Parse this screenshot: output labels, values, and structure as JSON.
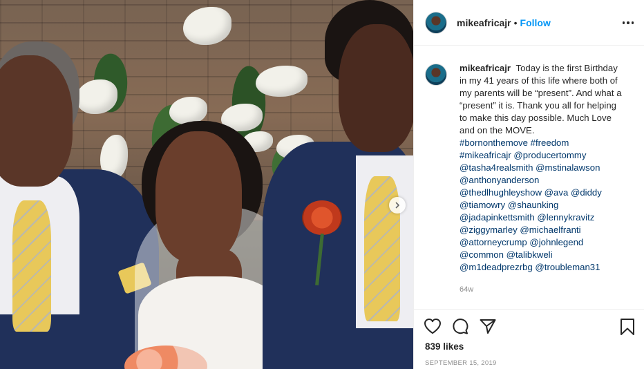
{
  "post": {
    "photo_alt": "",
    "author": "mikeafricajr",
    "separator": "•",
    "follow_label": "Follow",
    "caption_username": "mikeafricajr",
    "caption_text": "Today is the first Birthday in my 41 years of this life where both of my parents will be “present”. And what a “present” it is. Thank you all for helping to make this day possible. Much Love and on the MOVE.",
    "tags": [
      "#bornonthemove #freedom",
      "#mikeafricajr @producertommy",
      "@tasha4realsmith @mstinalawson",
      "@anthonyanderson",
      "@thedlhughleyshow @ava @diddy",
      "@tiamowry @shaunking",
      "@jadapinkettsmith @lennykravitz",
      "@ziggymarley @michaelfranti",
      "@attorneycrump @johnlegend",
      "@common @talibkweli",
      "@m1deadprezrbg @troubleman31"
    ],
    "age": "64w",
    "likes": "839 likes",
    "date": "SEPTEMBER 15, 2019"
  },
  "icons": {
    "like": "heart-icon",
    "comment": "comment-icon",
    "share": "share-icon",
    "save": "bookmark-icon",
    "more": "more-icon",
    "next": "chevron-right-icon"
  },
  "colors": {
    "follow": "#0095f6",
    "tag": "#00376b",
    "muted": "#8e8e8e"
  }
}
